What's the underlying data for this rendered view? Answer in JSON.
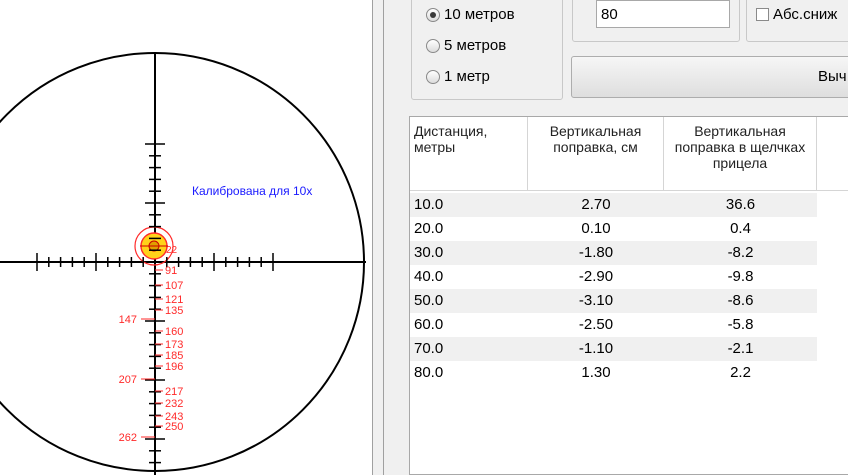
{
  "reticle": {
    "calibration_label": "Калибрована для 10x",
    "label_color": "#1a1aff",
    "mark_color": "#ff2a2a",
    "marks_right": [
      "91",
      "107",
      "121",
      "135",
      "160",
      "173",
      "185",
      "196",
      "217",
      "232",
      "243",
      "250"
    ],
    "marks_left": [
      "147",
      "207",
      "262"
    ]
  },
  "distance_step": {
    "options": [
      {
        "label": "10 метров",
        "selected": true
      },
      {
        "label": "5 метров",
        "selected": false
      },
      {
        "label": "1 метр",
        "selected": false
      }
    ]
  },
  "clicks_input": {
    "value": "80"
  },
  "abs_checkbox": {
    "label": "Абс.сниж",
    "checked": false
  },
  "calc_button": {
    "label": "Выч"
  },
  "table": {
    "headers": [
      "Дистанция, метры",
      "Вертикальная поправка, см",
      "Вертикальная поправка в щелчках прицела"
    ],
    "rows": [
      [
        "10.0",
        "2.70",
        "36.6"
      ],
      [
        "20.0",
        "0.10",
        "0.4"
      ],
      [
        "30.0",
        "-1.80",
        "-8.2"
      ],
      [
        "40.0",
        "-2.90",
        "-9.8"
      ],
      [
        "50.0",
        "-3.10",
        "-8.6"
      ],
      [
        "60.0",
        "-2.50",
        "-5.8"
      ],
      [
        "70.0",
        "-1.10",
        "-2.1"
      ],
      [
        "80.0",
        "1.30",
        "2.2"
      ]
    ]
  }
}
